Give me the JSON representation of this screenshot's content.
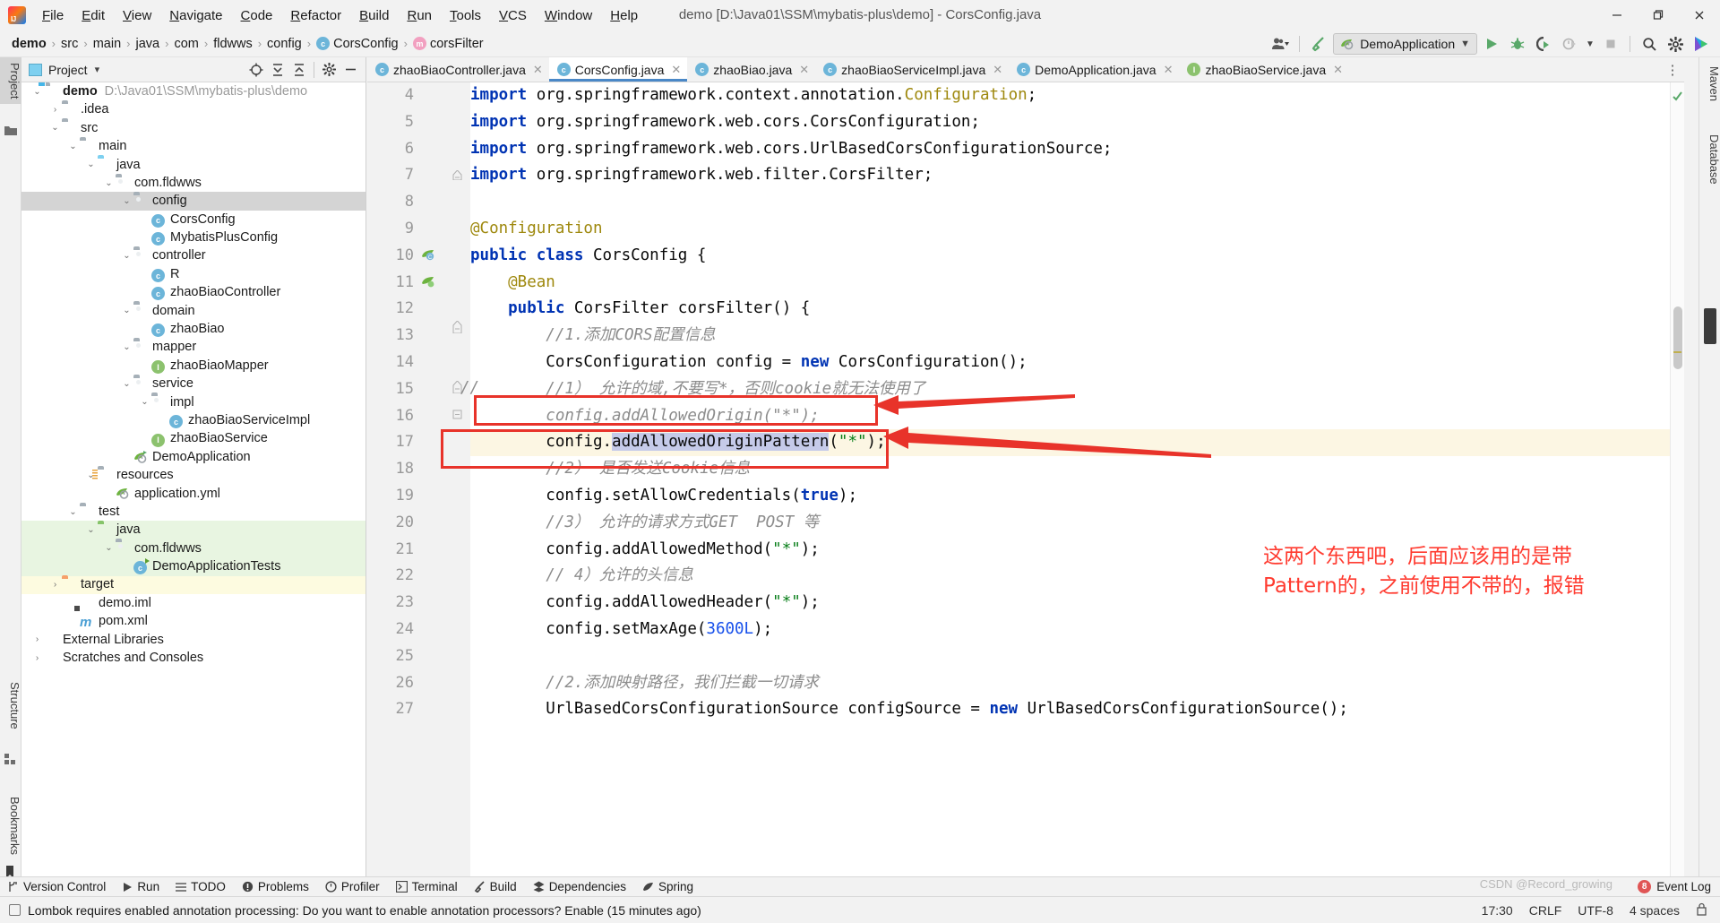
{
  "window": {
    "title": "demo [D:\\Java01\\SSM\\mybatis-plus\\demo] - CorsConfig.java",
    "minimize": "—",
    "maximize": "❐",
    "close": "✕"
  },
  "menubar": {
    "items": [
      {
        "label": "File"
      },
      {
        "label": "Edit"
      },
      {
        "label": "View"
      },
      {
        "label": "Navigate"
      },
      {
        "label": "Code"
      },
      {
        "label": "Refactor"
      },
      {
        "label": "Build"
      },
      {
        "label": "Run"
      },
      {
        "label": "Tools"
      },
      {
        "label": "VCS"
      },
      {
        "label": "Window"
      },
      {
        "label": "Help"
      }
    ]
  },
  "breadcrumb": {
    "items": [
      {
        "label": "demo",
        "icon": ""
      },
      {
        "label": "src",
        "icon": ""
      },
      {
        "label": "main",
        "icon": ""
      },
      {
        "label": "java",
        "icon": ""
      },
      {
        "label": "com",
        "icon": ""
      },
      {
        "label": "fldwws",
        "icon": ""
      },
      {
        "label": "config",
        "icon": ""
      },
      {
        "label": "CorsConfig",
        "icon": "c"
      },
      {
        "label": "corsFilter",
        "icon": "m"
      }
    ],
    "separator": "›"
  },
  "toolbar": {
    "run_configuration": "DemoApplication",
    "chevron": "∨",
    "buttons": [
      {
        "name": "run-button",
        "glyph": "▶"
      },
      {
        "name": "debug-button",
        "glyph": "🐞"
      },
      {
        "name": "run-with-coverage-button",
        "glyph": "▷"
      },
      {
        "name": "profiler-button",
        "glyph": "◴"
      },
      {
        "name": "stop-button",
        "glyph": "■"
      },
      {
        "name": "search-everywhere-button",
        "glyph": "🔍"
      },
      {
        "name": "settings-button",
        "glyph": "⚙"
      }
    ]
  },
  "left_strip": {
    "project_tab": "Project",
    "structure_tab": "Structure",
    "bookmarks_tab": "Bookmarks"
  },
  "right_strip": {
    "maven_tab": "Maven",
    "database_tab": "Database"
  },
  "project_panel": {
    "title": "Project",
    "dropdown": "▾",
    "icons": [
      {
        "name": "select-opened-file-icon",
        "glyph": "⊕"
      },
      {
        "name": "expand-all-icon",
        "glyph": "↧"
      },
      {
        "name": "collapse-all-icon",
        "glyph": "↥"
      },
      {
        "name": "settings-icon",
        "glyph": "⚙"
      },
      {
        "name": "hide-icon",
        "glyph": "—"
      }
    ],
    "tree": [
      {
        "label": "demo",
        "path": "D:\\Java01\\SSM\\mybatis-plus\\demo",
        "indent": 0,
        "arrow": "⌄",
        "icon": "folder-module",
        "bold": true,
        "bg": ""
      },
      {
        "label": ".idea",
        "indent": 1,
        "arrow": "›",
        "icon": "folder",
        "bg": ""
      },
      {
        "label": "src",
        "indent": 1,
        "arrow": "⌄",
        "icon": "folder",
        "bg": ""
      },
      {
        "label": "main",
        "indent": 2,
        "arrow": "⌄",
        "icon": "folder",
        "bg": ""
      },
      {
        "label": "java",
        "indent": 3,
        "arrow": "⌄",
        "icon": "folder-blue",
        "bg": ""
      },
      {
        "label": "com.fldwws",
        "indent": 4,
        "arrow": "⌄",
        "icon": "package",
        "bg": ""
      },
      {
        "label": "config",
        "indent": 5,
        "arrow": "⌄",
        "icon": "package",
        "bg": "sel"
      },
      {
        "label": "CorsConfig",
        "indent": 6,
        "arrow": "",
        "icon": "class",
        "bg": ""
      },
      {
        "label": "MybatisPlusConfig",
        "indent": 6,
        "arrow": "",
        "icon": "class",
        "bg": ""
      },
      {
        "label": "controller",
        "indent": 5,
        "arrow": "⌄",
        "icon": "package",
        "bg": ""
      },
      {
        "label": "R",
        "indent": 6,
        "arrow": "",
        "icon": "class",
        "bg": ""
      },
      {
        "label": "zhaoBiaoController",
        "indent": 6,
        "arrow": "",
        "icon": "class",
        "bg": ""
      },
      {
        "label": "domain",
        "indent": 5,
        "arrow": "⌄",
        "icon": "package",
        "bg": ""
      },
      {
        "label": "zhaoBiao",
        "indent": 6,
        "arrow": "",
        "icon": "class",
        "bg": ""
      },
      {
        "label": "mapper",
        "indent": 5,
        "arrow": "⌄",
        "icon": "package",
        "bg": ""
      },
      {
        "label": "zhaoBiaoMapper",
        "indent": 6,
        "arrow": "",
        "icon": "interface",
        "bg": ""
      },
      {
        "label": "service",
        "indent": 5,
        "arrow": "⌄",
        "icon": "package",
        "bg": ""
      },
      {
        "label": "impl",
        "indent": 6,
        "arrow": "⌄",
        "icon": "package",
        "bg": ""
      },
      {
        "label": "zhaoBiaoServiceImpl",
        "indent": 7,
        "arrow": "",
        "icon": "class",
        "bg": ""
      },
      {
        "label": "zhaoBiaoService",
        "indent": 6,
        "arrow": "",
        "icon": "interface",
        "bg": ""
      },
      {
        "label": "DemoApplication",
        "indent": 5,
        "arrow": "",
        "icon": "spring-run",
        "bg": ""
      },
      {
        "label": "resources",
        "indent": 3,
        "arrow": "⌄",
        "icon": "folder-res",
        "bg": ""
      },
      {
        "label": "application.yml",
        "indent": 4,
        "arrow": "",
        "icon": "spring-yml",
        "bg": ""
      },
      {
        "label": "test",
        "indent": 2,
        "arrow": "⌄",
        "icon": "folder",
        "bg": ""
      },
      {
        "label": "java",
        "indent": 3,
        "arrow": "⌄",
        "icon": "folder-green",
        "bg": "green"
      },
      {
        "label": "com.fldwws",
        "indent": 4,
        "arrow": "⌄",
        "icon": "package",
        "bg": "green"
      },
      {
        "label": "DemoApplicationTests",
        "indent": 5,
        "arrow": "",
        "icon": "test-class",
        "bg": "green"
      },
      {
        "label": "target",
        "indent": 1,
        "arrow": "›",
        "icon": "folder-orange",
        "bg": "yellow"
      },
      {
        "label": "demo.iml",
        "indent": 2,
        "arrow": "",
        "icon": "iml",
        "bg": ""
      },
      {
        "label": "pom.xml",
        "indent": 2,
        "arrow": "",
        "icon": "maven",
        "bg": ""
      },
      {
        "label": "External Libraries",
        "indent": 0,
        "arrow": "›",
        "icon": "library",
        "bg": ""
      },
      {
        "label": "Scratches and Consoles",
        "indent": 0,
        "arrow": "›",
        "icon": "scratch",
        "bg": ""
      }
    ]
  },
  "editor": {
    "tabs": [
      {
        "label": "zhaoBiaoController.java",
        "icon": "c",
        "active": false
      },
      {
        "label": "CorsConfig.java",
        "icon": "c",
        "active": true
      },
      {
        "label": "zhaoBiao.java",
        "icon": "c",
        "active": false
      },
      {
        "label": "zhaoBiaoServiceImpl.java",
        "icon": "c",
        "active": false
      },
      {
        "label": "DemoApplication.java",
        "icon": "c",
        "active": false
      },
      {
        "label": "zhaoBiaoService.java",
        "icon": "i",
        "active": false
      }
    ],
    "tab_close_glyph": "✕",
    "tab_more_glyph": "⋮",
    "first_line_number": 4,
    "lines": [
      {
        "no": 4,
        "tokens": [
          {
            "t": "import ",
            "c": "kw"
          },
          {
            "t": "org.springframework.context.annotation.",
            "c": ""
          },
          {
            "t": "Configuration",
            "c": "cls"
          },
          {
            "t": ";",
            "c": ""
          }
        ]
      },
      {
        "no": 5,
        "tokens": [
          {
            "t": "import ",
            "c": "kw"
          },
          {
            "t": "org.springframework.web.cors.CorsConfiguration;",
            "c": ""
          }
        ]
      },
      {
        "no": 6,
        "tokens": [
          {
            "t": "import ",
            "c": "kw"
          },
          {
            "t": "org.springframework.web.cors.UrlBasedCorsConfigurationSource;",
            "c": ""
          }
        ]
      },
      {
        "no": 7,
        "tokens": [
          {
            "t": "import ",
            "c": "kw"
          },
          {
            "t": "org.springframework.web.filter.CorsFilter;",
            "c": ""
          }
        ]
      },
      {
        "no": 8,
        "tokens": [
          {
            "t": "",
            "c": ""
          }
        ]
      },
      {
        "no": 9,
        "tokens": [
          {
            "t": "@Configuration",
            "c": "ann"
          }
        ]
      },
      {
        "no": 10,
        "tokens": [
          {
            "t": "public class ",
            "c": "kw"
          },
          {
            "t": "CorsConfig {",
            "c": ""
          }
        ]
      },
      {
        "no": 11,
        "tokens": [
          {
            "t": "    @Bean",
            "c": "ann"
          }
        ]
      },
      {
        "no": 12,
        "tokens": [
          {
            "t": "    public ",
            "c": "kw"
          },
          {
            "t": "CorsFilter corsFilter() {",
            "c": ""
          }
        ]
      },
      {
        "no": 13,
        "tokens": [
          {
            "t": "        //1.添加CORS配置信息",
            "c": "cmt"
          }
        ]
      },
      {
        "no": 14,
        "tokens": [
          {
            "t": "        CorsConfiguration config = ",
            "c": ""
          },
          {
            "t": "new ",
            "c": "kw"
          },
          {
            "t": "CorsConfiguration();",
            "c": ""
          }
        ]
      },
      {
        "no": 15,
        "tokens": [
          {
            "t": "        //1） 允许的域,不要写*，否则cookie就无法使用了",
            "c": "cmt"
          }
        ]
      },
      {
        "no": 16,
        "tokens": [
          {
            "t": "        config.addAllowedOrigin(\"*\");",
            "c": "cmt"
          }
        ],
        "commented": true
      },
      {
        "no": 17,
        "tokens": [
          {
            "t": "        config.",
            "c": ""
          },
          {
            "t": "addAllowedOriginPattern",
            "c": "selt"
          },
          {
            "t": "(",
            "c": ""
          },
          {
            "t": "\"*\"",
            "c": "str"
          },
          {
            "t": ");",
            "c": ""
          }
        ],
        "highlight": true
      },
      {
        "no": 18,
        "tokens": [
          {
            "t": "        //2） 是否发送Cookie信息",
            "c": "cmt"
          }
        ]
      },
      {
        "no": 19,
        "tokens": [
          {
            "t": "        config.setAllowCredentials(",
            "c": ""
          },
          {
            "t": "true",
            "c": "kw"
          },
          {
            "t": ");",
            "c": ""
          }
        ]
      },
      {
        "no": 20,
        "tokens": [
          {
            "t": "        //3） 允许的请求方式GET  POST 等",
            "c": "cmt"
          }
        ]
      },
      {
        "no": 21,
        "tokens": [
          {
            "t": "        config.addAllowedMethod(",
            "c": ""
          },
          {
            "t": "\"*\"",
            "c": "str"
          },
          {
            "t": ");",
            "c": ""
          }
        ]
      },
      {
        "no": 22,
        "tokens": [
          {
            "t": "        // 4）允许的头信息",
            "c": "cmt"
          }
        ]
      },
      {
        "no": 23,
        "tokens": [
          {
            "t": "        config.addAllowedHeader(",
            "c": ""
          },
          {
            "t": "\"*\"",
            "c": "str"
          },
          {
            "t": ");",
            "c": ""
          }
        ]
      },
      {
        "no": 24,
        "tokens": [
          {
            "t": "        config.setMaxAge(",
            "c": ""
          },
          {
            "t": "3600L",
            "c": "num"
          },
          {
            "t": ");",
            "c": ""
          }
        ]
      },
      {
        "no": 25,
        "tokens": [
          {
            "t": "",
            "c": ""
          }
        ]
      },
      {
        "no": 26,
        "tokens": [
          {
            "t": "        //2.添加映射路径，我们拦截一切请求",
            "c": "cmt"
          }
        ]
      },
      {
        "no": 27,
        "tokens": [
          {
            "t": "        UrlBasedCorsConfigurationSource configSource = ",
            "c": ""
          },
          {
            "t": "new ",
            "c": "kw"
          },
          {
            "t": "UrlBasedCorsConfigurationSource();",
            "c": ""
          }
        ]
      }
    ],
    "line16_comment_marker": "//"
  },
  "annotation": {
    "note_line1": "这两个东西吧，后面应该用的是带",
    "note_line2": "Pattern的，之前使用不带的，报错",
    "color": "#ff3b30",
    "box_color": "#e8332a"
  },
  "tool_window_bar": {
    "items": [
      {
        "label": "Version Control",
        "icon": "branch-icon"
      },
      {
        "label": "Run",
        "icon": "play-icon"
      },
      {
        "label": "TODO",
        "icon": "list-icon"
      },
      {
        "label": "Problems",
        "icon": "warning-icon"
      },
      {
        "label": "Profiler",
        "icon": "gauge-icon"
      },
      {
        "label": "Terminal",
        "icon": "terminal-icon"
      },
      {
        "label": "Build",
        "icon": "hammer-icon"
      },
      {
        "label": "Dependencies",
        "icon": "layers-icon"
      },
      {
        "label": "Spring",
        "icon": "leaf-icon"
      }
    ],
    "event_log": "Event Log",
    "event_count": "8"
  },
  "status_bar": {
    "message": "Lombok requires enabled annotation processing: Do you want to enable annotation processors? Enable (15 minutes ago)",
    "time": "17:30",
    "line_sep": "CRLF",
    "encoding": "UTF-8",
    "indent": "4 spaces",
    "watermark": "CSDN @Record_growing"
  }
}
